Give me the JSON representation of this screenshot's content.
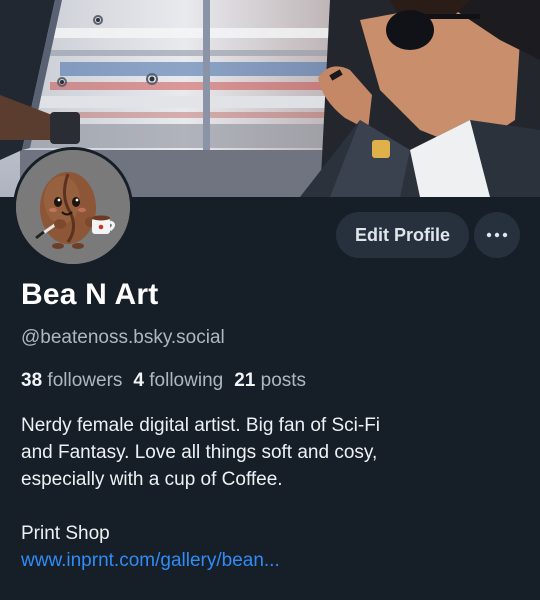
{
  "profile": {
    "display_name": "Bea N Art",
    "handle": "@beatenoss.bsky.social",
    "edit_label": "Edit Profile",
    "more_icon": "ellipsis-icon",
    "avatar_icon": "coffee-bean-character",
    "banner_image": "illustration-man-with-sunglasses-in-car"
  },
  "stats": {
    "followers_count": "38",
    "followers_label": "followers",
    "following_count": "4",
    "following_label": "following",
    "posts_count": "21",
    "posts_label": "posts"
  },
  "bio": {
    "lines": [
      "Nerdy female digital artist. Big fan of Sci-Fi",
      "and Fantasy. Love all things soft and cosy,",
      "especially with a cup of Coffee."
    ],
    "shop_label": "Print Shop",
    "shop_link": "www.inprnt.com/gallery/bean..."
  },
  "colors": {
    "background": "#161e27",
    "button": "#27313d",
    "link": "#2f8cf7",
    "muted_text": "#aeb7c1"
  }
}
